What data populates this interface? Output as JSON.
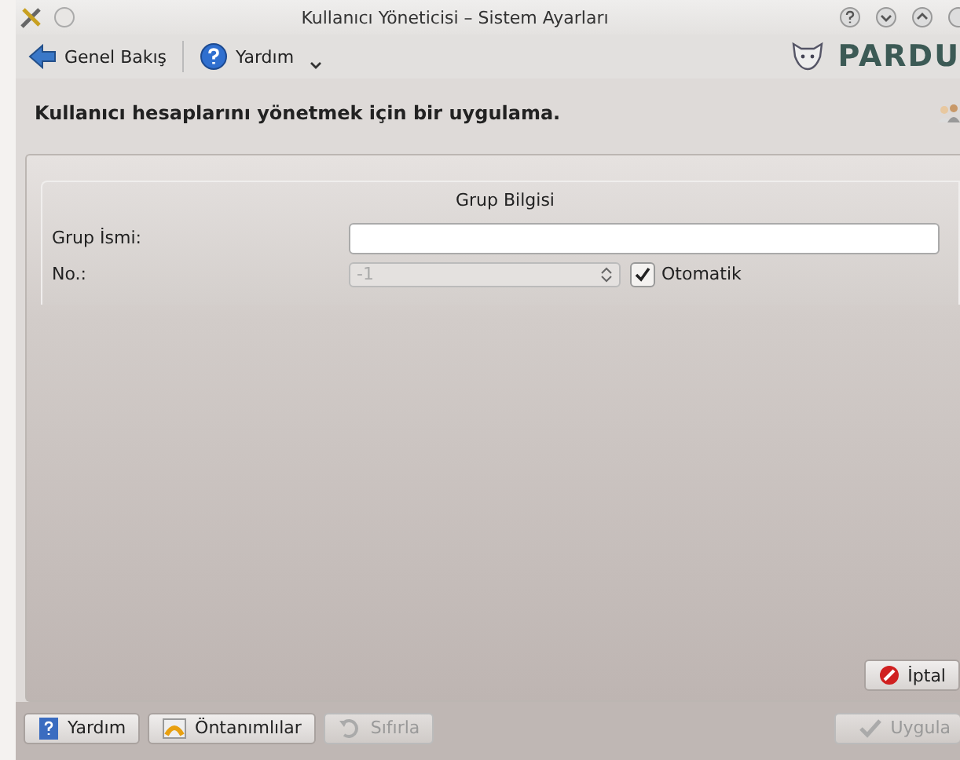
{
  "window": {
    "title": "Kullanıcı Yöneticisi – Sistem Ayarları"
  },
  "toolbar": {
    "items": [
      {
        "label": "Genel Bakış",
        "kind": "back"
      },
      {
        "label": "Yardım",
        "kind": "help"
      }
    ],
    "logo": "PARDU"
  },
  "header": {
    "text": "Kullanıcı hesaplarını yönetmek için bir uygulama."
  },
  "group": {
    "title": "Grup Bilgisi",
    "name_field": {
      "label": "Grup İsmi:"
    },
    "number_field": {
      "label": "No.:",
      "value": "-1",
      "disabled": true
    },
    "auto_checkbox": {
      "label": "Otomatik",
      "checked": true
    }
  },
  "cancel_button": {
    "label": "İptal"
  },
  "buttons": [
    {
      "label": "Yardım",
      "kind": "help",
      "disabled": false
    },
    {
      "label": "Öntanımlılar",
      "kind": "defaults",
      "disabled": false
    },
    {
      "label": "Sıfırla",
      "kind": "reset",
      "disabled": true
    },
    {
      "label": "Uygula",
      "kind": "apply",
      "disabled": true
    }
  ]
}
